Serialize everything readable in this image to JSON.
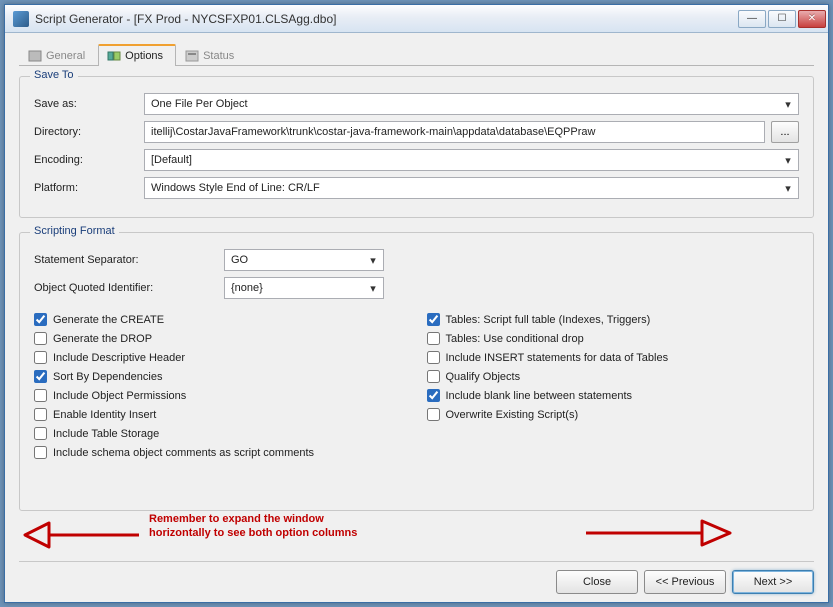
{
  "window": {
    "title": "Script Generator - [FX Prod - NYCSFXP01.CLSAgg.dbo]"
  },
  "tabs": {
    "general": "General",
    "options": "Options",
    "status": "Status"
  },
  "save_to": {
    "legend": "Save To",
    "save_as_label": "Save as:",
    "save_as_value": "One File Per Object",
    "directory_label": "Directory:",
    "directory_value": "itellij\\CostarJavaFramework\\trunk\\costar-java-framework-main\\appdata\\database\\EQPPraw",
    "browse_label": "...",
    "encoding_label": "Encoding:",
    "encoding_value": "[Default]",
    "platform_label": "Platform:",
    "platform_value": "Windows Style End of Line: CR/LF"
  },
  "scripting": {
    "legend": "Scripting Format",
    "separator_label": "Statement Separator:",
    "separator_value": "GO",
    "quoted_label": "Object Quoted Identifier:",
    "quoted_value": "{none}",
    "left": {
      "create": "Generate the CREATE",
      "drop": "Generate the DROP",
      "header": "Include Descriptive Header",
      "sort": "Sort By Dependencies",
      "perms": "Include Object Permissions",
      "identity": "Enable Identity Insert",
      "storage": "Include Table Storage",
      "comments": "Include schema object comments as script comments"
    },
    "right": {
      "fulltable": "Tables: Script full table (Indexes, Triggers)",
      "conddrop": "Tables: Use conditional drop",
      "insert": "Include INSERT statements for data of Tables",
      "qualify": "Qualify Objects",
      "blank": "Include blank line between statements",
      "overwrite": "Overwrite Existing Script(s)"
    }
  },
  "annotation": {
    "line1": "Remember to expand the window",
    "line2": "horizontally to see both option columns"
  },
  "buttons": {
    "close": "Close",
    "prev": "<< Previous",
    "next": "Next >>"
  }
}
